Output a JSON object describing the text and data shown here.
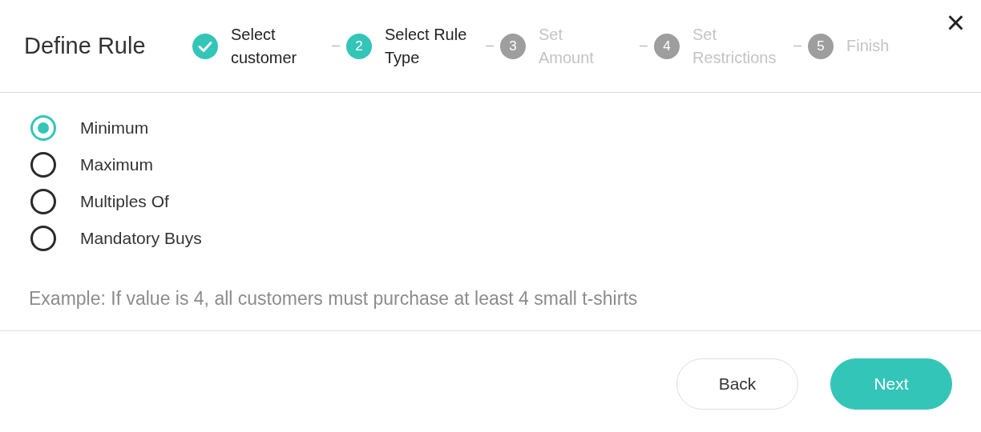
{
  "dialog": {
    "title": "Define Rule",
    "close_label": "×"
  },
  "steps": [
    {
      "kind": "done",
      "label": "Select\ncustomer"
    },
    {
      "kind": "current",
      "number": "2",
      "label": "Select Rule\nType"
    },
    {
      "kind": "upcoming",
      "number": "3",
      "label": "Set\nAmount"
    },
    {
      "kind": "upcoming",
      "number": "4",
      "label": "Set\nRestrictions"
    },
    {
      "kind": "upcoming",
      "number": "5",
      "label": "Finish"
    }
  ],
  "options": [
    {
      "label": "Minimum",
      "selected": true
    },
    {
      "label": "Maximum",
      "selected": false
    },
    {
      "label": "Multiples Of",
      "selected": false
    },
    {
      "label": "Mandatory Buys",
      "selected": false
    }
  ],
  "example": "Example: If value is 4, all customers must purchase at least 4 small t-shirts",
  "buttons": [
    {
      "kind": "secondary",
      "label": "Back"
    },
    {
      "kind": "primary",
      "label": "Next"
    }
  ]
}
